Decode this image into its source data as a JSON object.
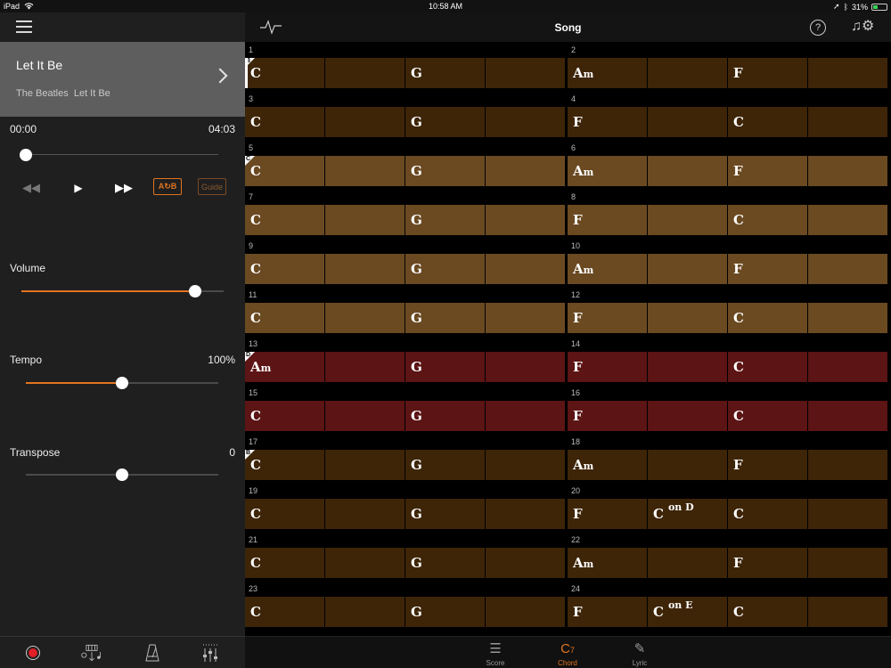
{
  "status": {
    "device": "iPad",
    "time": "10:58 AM",
    "battery": "31%"
  },
  "song": {
    "title": "Let It Be",
    "artist": "The Beatles",
    "album": "Let It Be"
  },
  "playback": {
    "elapsed": "00:00",
    "duration": "04:03",
    "position": 0.0
  },
  "transport": {
    "ab_label": "A↻B",
    "guide_label": "Guide"
  },
  "controls": {
    "volume": {
      "label": "Volume",
      "level": 0.86
    },
    "tempo": {
      "label": "Tempo",
      "value": "100%",
      "level": 0.5
    },
    "transpose": {
      "label": "Transpose",
      "value": "0",
      "level": 0.5
    }
  },
  "header": {
    "title": "Song"
  },
  "tabs": [
    {
      "label": "Score",
      "icon": "score-icon"
    },
    {
      "label": "Chord",
      "icon": "chord-icon",
      "active": true
    },
    {
      "label": "Lyric",
      "icon": "lyric-icon"
    }
  ],
  "section_colors": {
    "dark": "#3e2508",
    "light": "#6b4a22",
    "red": "#5c1414"
  },
  "accent": "#e07420",
  "bars": [
    {
      "num": "1",
      "section": "B",
      "color": "dark",
      "chords": [
        {
          "root": "C",
          "beat": 0
        },
        {
          "root": "G",
          "beat": 2
        }
      ]
    },
    {
      "num": "2",
      "color": "dark",
      "chords": [
        {
          "root": "A",
          "suffix": "m",
          "beat": 0
        },
        {
          "root": "F",
          "beat": 2
        }
      ]
    },
    {
      "num": "3",
      "color": "dark",
      "chords": [
        {
          "root": "C",
          "beat": 0
        },
        {
          "root": "G",
          "beat": 2
        }
      ]
    },
    {
      "num": "4",
      "color": "dark",
      "chords": [
        {
          "root": "F",
          "beat": 0
        },
        {
          "root": "C",
          "beat": 2
        }
      ]
    },
    {
      "num": "5",
      "section": "C",
      "color": "light",
      "chords": [
        {
          "root": "C",
          "beat": 0
        },
        {
          "root": "G",
          "beat": 2
        }
      ]
    },
    {
      "num": "6",
      "color": "light",
      "chords": [
        {
          "root": "A",
          "suffix": "m",
          "beat": 0
        },
        {
          "root": "F",
          "beat": 2
        }
      ]
    },
    {
      "num": "7",
      "color": "light",
      "chords": [
        {
          "root": "C",
          "beat": 0
        },
        {
          "root": "G",
          "beat": 2
        }
      ]
    },
    {
      "num": "8",
      "color": "light",
      "chords": [
        {
          "root": "F",
          "beat": 0
        },
        {
          "root": "C",
          "beat": 2
        }
      ]
    },
    {
      "num": "9",
      "color": "light",
      "chords": [
        {
          "root": "C",
          "beat": 0
        },
        {
          "root": "G",
          "beat": 2
        }
      ]
    },
    {
      "num": "10",
      "color": "light",
      "chords": [
        {
          "root": "A",
          "suffix": "m",
          "beat": 0
        },
        {
          "root": "F",
          "beat": 2
        }
      ]
    },
    {
      "num": "11",
      "color": "light",
      "chords": [
        {
          "root": "C",
          "beat": 0
        },
        {
          "root": "G",
          "beat": 2
        }
      ]
    },
    {
      "num": "12",
      "color": "light",
      "chords": [
        {
          "root": "F",
          "beat": 0
        },
        {
          "root": "C",
          "beat": 2
        }
      ]
    },
    {
      "num": "13",
      "section": "D",
      "color": "red",
      "chords": [
        {
          "root": "A",
          "suffix": "m",
          "beat": 0
        },
        {
          "root": "G",
          "beat": 2
        }
      ]
    },
    {
      "num": "14",
      "color": "red",
      "chords": [
        {
          "root": "F",
          "beat": 0
        },
        {
          "root": "C",
          "beat": 2
        }
      ]
    },
    {
      "num": "15",
      "color": "red",
      "chords": [
        {
          "root": "C",
          "beat": 0
        },
        {
          "root": "G",
          "beat": 2
        }
      ]
    },
    {
      "num": "16",
      "color": "red",
      "chords": [
        {
          "root": "F",
          "beat": 0
        },
        {
          "root": "C",
          "beat": 2
        }
      ]
    },
    {
      "num": "17",
      "section": "B",
      "color": "dark",
      "chords": [
        {
          "root": "C",
          "beat": 0
        },
        {
          "root": "G",
          "beat": 2
        }
      ]
    },
    {
      "num": "18",
      "color": "dark",
      "chords": [
        {
          "root": "A",
          "suffix": "m",
          "beat": 0
        },
        {
          "root": "F",
          "beat": 2
        }
      ]
    },
    {
      "num": "19",
      "color": "dark",
      "chords": [
        {
          "root": "C",
          "beat": 0
        },
        {
          "root": "G",
          "beat": 2
        }
      ]
    },
    {
      "num": "20",
      "color": "dark",
      "chords": [
        {
          "root": "F",
          "beat": 0
        },
        {
          "root": "C",
          "on": "on D",
          "beat": 1
        },
        {
          "root": "C",
          "beat": 2
        }
      ]
    },
    {
      "num": "21",
      "color": "dark",
      "chords": [
        {
          "root": "C",
          "beat": 0
        },
        {
          "root": "G",
          "beat": 2
        }
      ]
    },
    {
      "num": "22",
      "color": "dark",
      "chords": [
        {
          "root": "A",
          "suffix": "m",
          "beat": 0
        },
        {
          "root": "F",
          "beat": 2
        }
      ]
    },
    {
      "num": "23",
      "color": "dark",
      "chords": [
        {
          "root": "C",
          "beat": 0
        },
        {
          "root": "G",
          "beat": 2
        }
      ]
    },
    {
      "num": "24",
      "color": "dark",
      "chords": [
        {
          "root": "F",
          "beat": 0
        },
        {
          "root": "C",
          "on": "on E",
          "beat": 1
        },
        {
          "root": "C",
          "beat": 2
        }
      ]
    }
  ]
}
